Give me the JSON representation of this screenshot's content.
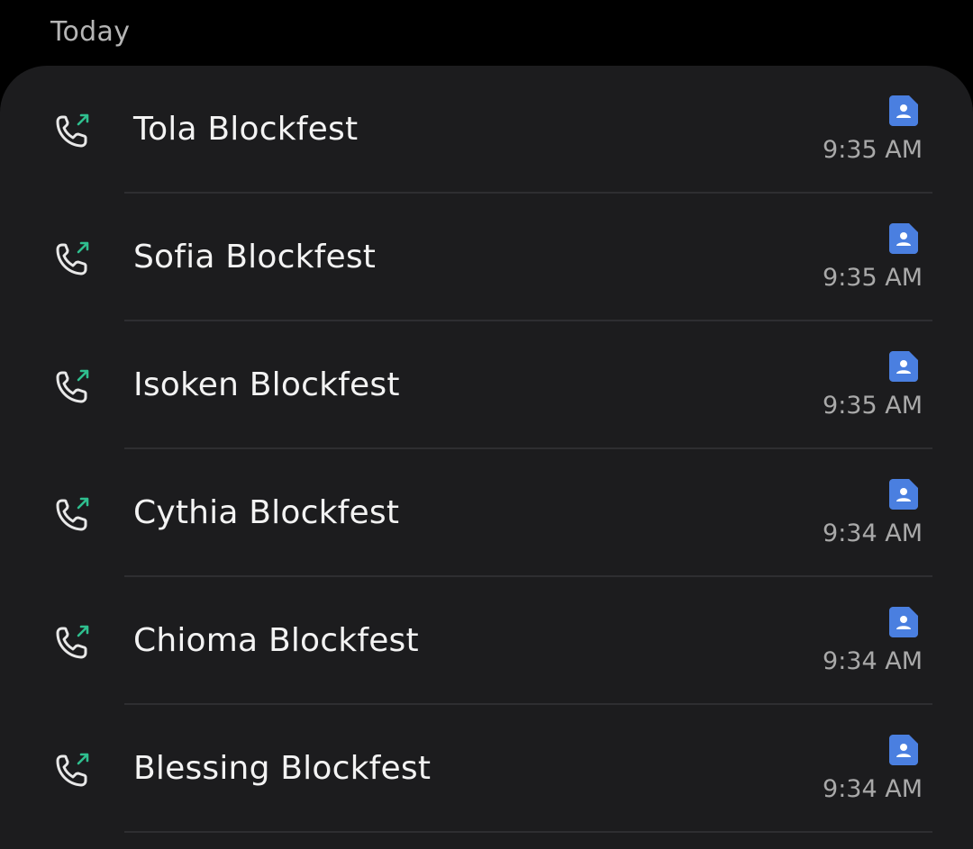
{
  "section": {
    "title": "Today"
  },
  "calls": [
    {
      "name": "Tola Blockfest",
      "time": "9:35 AM",
      "direction": "outgoing",
      "icon": "outgoing-call-icon",
      "sim_icon": "contact-sim-icon"
    },
    {
      "name": "Sofia Blockfest",
      "time": "9:35 AM",
      "direction": "outgoing",
      "icon": "outgoing-call-icon",
      "sim_icon": "contact-sim-icon"
    },
    {
      "name": "Isoken Blockfest",
      "time": "9:35 AM",
      "direction": "outgoing",
      "icon": "outgoing-call-icon",
      "sim_icon": "contact-sim-icon"
    },
    {
      "name": "Cythia Blockfest",
      "time": "9:34 AM",
      "direction": "outgoing",
      "icon": "outgoing-call-icon",
      "sim_icon": "contact-sim-icon"
    },
    {
      "name": "Chioma Blockfest",
      "time": "9:34 AM",
      "direction": "outgoing",
      "icon": "outgoing-call-icon",
      "sim_icon": "contact-sim-icon"
    },
    {
      "name": "Blessing Blockfest",
      "time": "9:34 AM",
      "direction": "outgoing",
      "icon": "outgoing-call-icon",
      "sim_icon": "contact-sim-icon"
    }
  ],
  "colors": {
    "background": "#000000",
    "card": "#1c1c1e",
    "outgoing_arrow": "#2fbf8f",
    "sim_badge": "#4a7fe0",
    "name_text": "#f3f3f3",
    "secondary_text": "#a9a9a9"
  }
}
